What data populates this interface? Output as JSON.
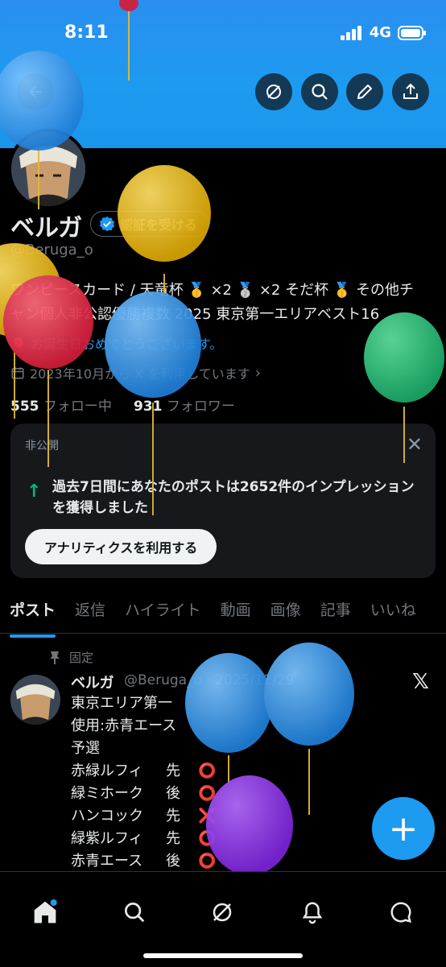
{
  "status": {
    "time": "8:11",
    "network": "4G"
  },
  "profile": {
    "name": "ベルガ",
    "verify_label": "認証を受ける",
    "handle": "@Beruga_o",
    "bio_line1": "ワンピースカード / 天竜杯 🥇 ×2 🥈 ×2 そだ杯 🥇 その他チ",
    "bio_line2": "ャン個人非公認優勝複数 2025 東京第一エリアベスト16",
    "birthday": "🎈 お誕生日おめでとうございます。",
    "joined": "2023年10月から X を利用しています",
    "following_count": "555",
    "following_label": "フォロー中",
    "followers_count": "931",
    "followers_label": "フォロワー"
  },
  "card": {
    "tag": "非公開",
    "message": "過去7日間にあなたのポストは2652件のインプレッションを獲得しました",
    "button": "アナリティクスを利用する",
    "close": "✕"
  },
  "tabs": [
    "ポスト",
    "返信",
    "ハイライト",
    "動画",
    "画像",
    "記事",
    "いいね"
  ],
  "post": {
    "pinned_label": "固定",
    "author": "ベルガ",
    "meta": "@Beruga_o · 2025/11/29",
    "lines": [
      {
        "a": "東京エリア第一",
        "b": "",
        "c": ""
      },
      {
        "a": "使用:赤青エース",
        "b": "",
        "c": ""
      },
      {
        "a": "予選",
        "b": "",
        "c": ""
      },
      {
        "a": "赤緑ルフィ",
        "b": "先",
        "c": "⭕"
      },
      {
        "a": "緑ミホーク",
        "b": "後",
        "c": "⭕"
      },
      {
        "a": "ハンコック",
        "b": "先",
        "c": "❌"
      },
      {
        "a": "緑紫ルフィ",
        "b": "先",
        "c": "⭕"
      },
      {
        "a": "赤青エース",
        "b": "後",
        "c": "⭕"
      }
    ]
  },
  "icons": {
    "header": [
      "grok-icon",
      "search-icon",
      "edit-icon",
      "share-icon"
    ],
    "nav": [
      "home-icon",
      "search-icon",
      "grok-icon",
      "notifications-icon",
      "messages-icon"
    ]
  },
  "colors": {
    "accent": "#1d9bf0",
    "banner": "#1d9bf0",
    "verified": "#1d9bf0",
    "positive": "#00ba7c"
  }
}
